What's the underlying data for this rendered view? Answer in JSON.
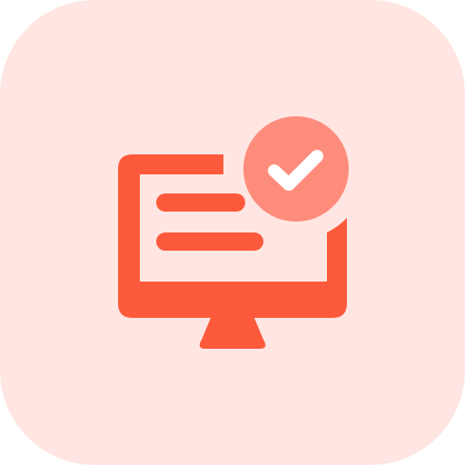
{
  "icon": {
    "name": "monitor-check-icon",
    "colors": {
      "background": "#FFE6E2",
      "primary": "#FD5A3C",
      "accent": "#FE8C7C",
      "check": "#FFFFFF"
    }
  }
}
